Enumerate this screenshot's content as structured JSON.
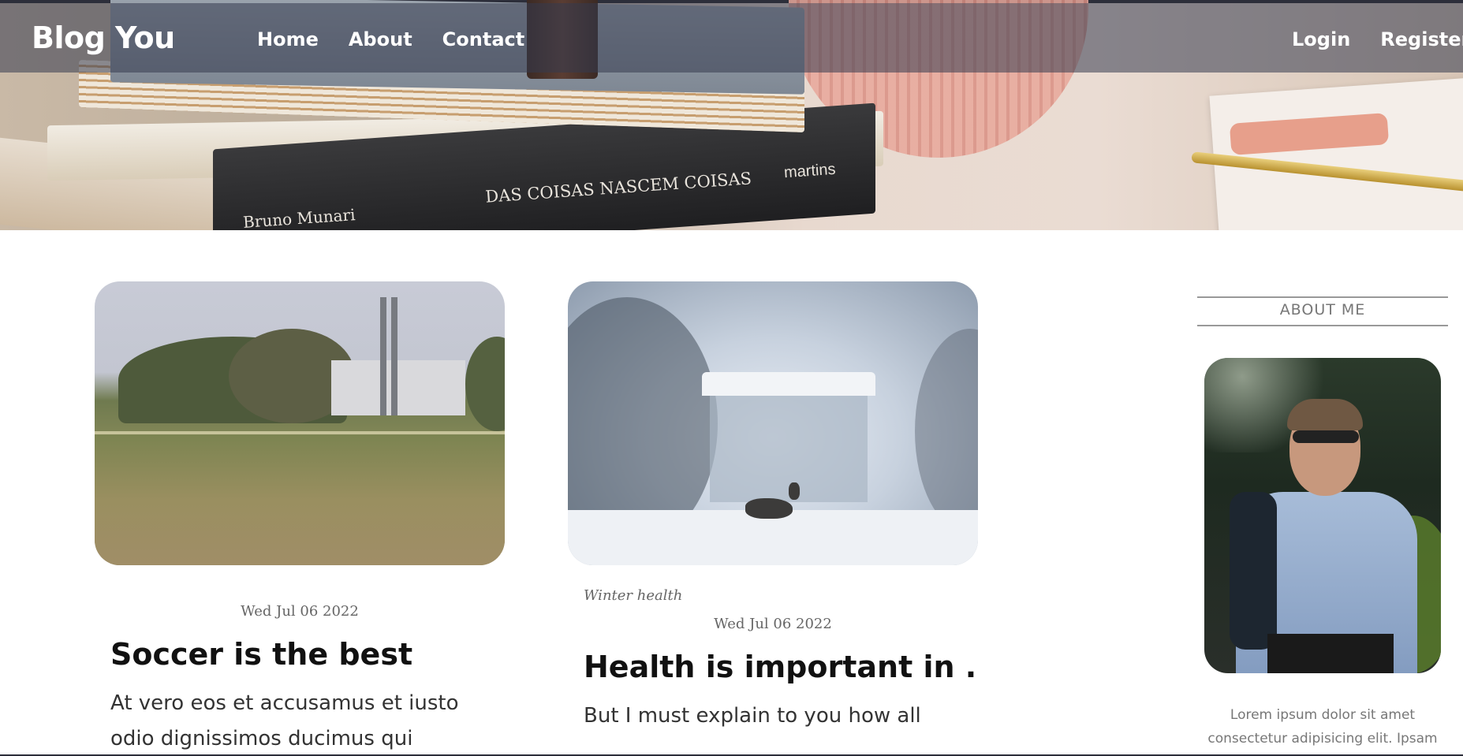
{
  "header": {
    "brand": "Blog You",
    "nav": [
      {
        "label": "Home"
      },
      {
        "label": "About"
      },
      {
        "label": "Contact"
      }
    ],
    "auth": [
      {
        "label": "Login"
      },
      {
        "label": "Register"
      }
    ],
    "hero_text": {
      "spine_title": "DAS COISAS NASCEM COISAS",
      "spine_author": "Bruno Munari",
      "spine_publisher": "martins"
    }
  },
  "posts": [
    {
      "category": "",
      "date": "Wed Jul 06 2022",
      "title": "Soccer is the best",
      "excerpt": "At vero eos et accusamus et iusto odio dignissimos ducimus qui"
    },
    {
      "category": "Winter health",
      "date": "Wed Jul 06 2022",
      "title": "Health is important in ...",
      "excerpt": "But I must explain to you how all"
    }
  ],
  "sidebar": {
    "heading": "ABOUT ME",
    "text": "Lorem ipsum dolor sit amet consectetur adipisicing elit. Ipsam"
  },
  "colors": {
    "navbar_overlay": "#343a4e",
    "text_dark": "#111111",
    "muted": "#777777"
  }
}
